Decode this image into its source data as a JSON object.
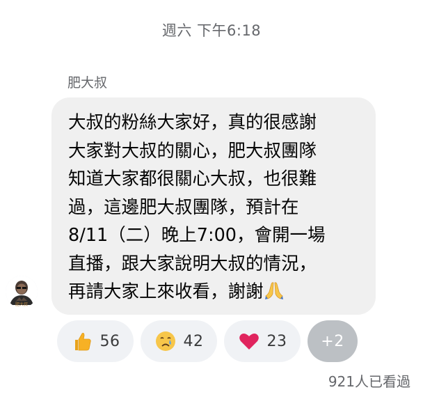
{
  "header": {
    "timestamp": "週六 下午6:18"
  },
  "message": {
    "sender": "肥大叔",
    "avatar_label": "肥大叔",
    "text": "大叔的粉絲大家好，真的很感謝\n大家對大叔的關心，肥大叔團隊\n知道大家都很關心大叔，也很難\n過，這邊肥大叔團隊，預計在\n8/11（二）晚上7:00，會開一場\n直播，跟大家說明大叔的情況，\n再請大家上來收看，謝謝",
    "trailing_emoji": "folded-hands-icon"
  },
  "reactions": [
    {
      "icon": "thumbs-up-icon",
      "count": "56"
    },
    {
      "icon": "crying-face-icon",
      "count": "42"
    },
    {
      "icon": "heart-icon",
      "count": "23"
    }
  ],
  "more_reactions": "+2",
  "seen_by": "921人已看過",
  "colors": {
    "bubble_bg": "#f0f0f0",
    "chip_bg": "#f0f2f5",
    "more_chip_bg": "#bcc0c4",
    "secondary_text": "#65676b",
    "heart": "#e0245e",
    "thumb": "#f7b125"
  }
}
